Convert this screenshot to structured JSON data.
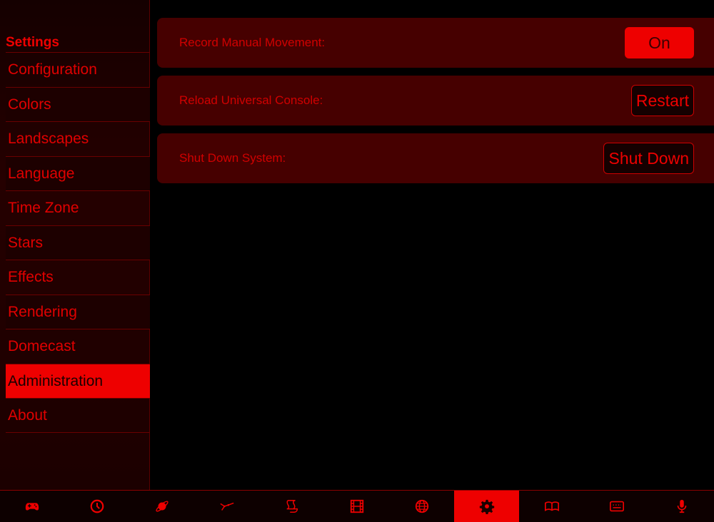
{
  "sidebar": {
    "title": "Settings",
    "items": [
      {
        "label": "Configuration"
      },
      {
        "label": "Colors"
      },
      {
        "label": "Landscapes"
      },
      {
        "label": "Language"
      },
      {
        "label": "Time Zone"
      },
      {
        "label": "Stars"
      },
      {
        "label": "Effects"
      },
      {
        "label": "Rendering"
      },
      {
        "label": "Domecast"
      },
      {
        "label": "Administration",
        "active": true
      },
      {
        "label": "About"
      }
    ]
  },
  "main": {
    "rows": [
      {
        "label": "Record Manual Movement:",
        "button": "On"
      },
      {
        "label": "Reload Universal Console:",
        "button": "Restart"
      },
      {
        "label": "Shut Down System:",
        "button": "Shut Down"
      }
    ]
  },
  "toolbar": {
    "icons": [
      "gamepad-icon",
      "clock-icon",
      "planet-icon",
      "constellation-icon",
      "script-icon",
      "film-icon",
      "globe-icon",
      "gear-icon",
      "book-icon",
      "keyboard-icon",
      "microphone-icon"
    ],
    "active": "gear-icon"
  },
  "colors": {
    "accent": "#ee0000",
    "row_background": "#460000",
    "background": "#000000"
  }
}
